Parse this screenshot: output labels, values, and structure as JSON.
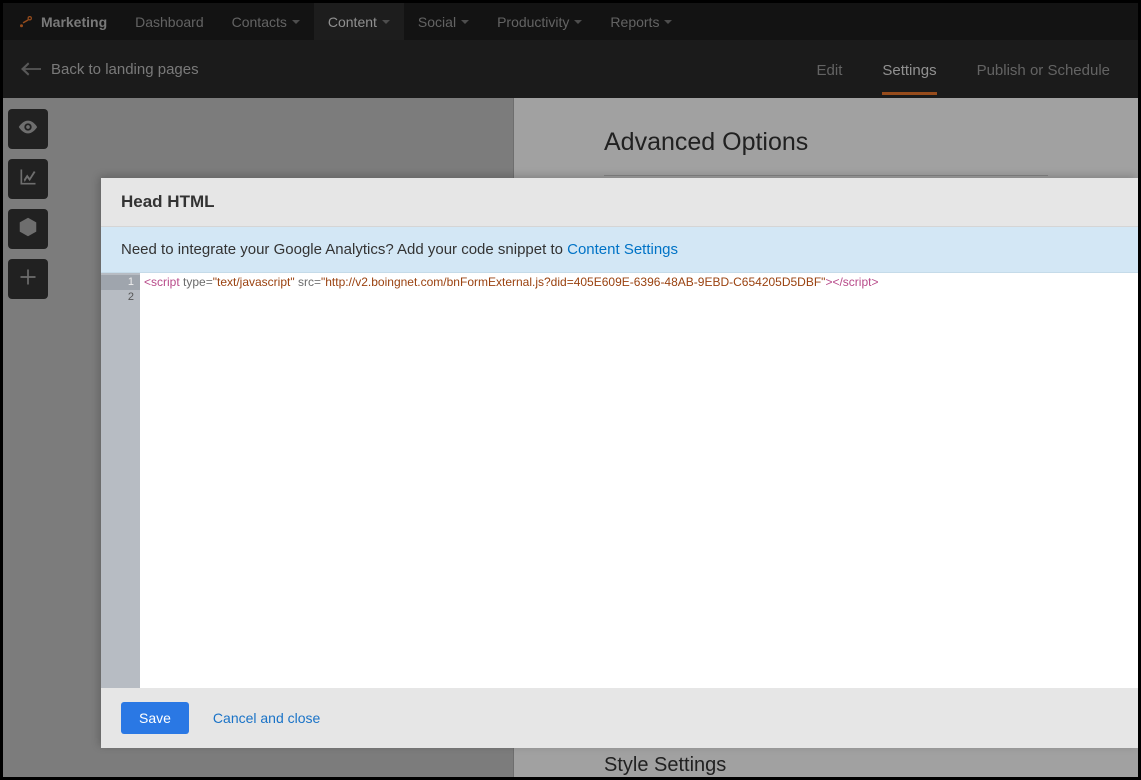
{
  "brand": "Marketing",
  "nav": {
    "dashboard": "Dashboard",
    "contacts": "Contacts",
    "content": "Content",
    "social": "Social",
    "productivity": "Productivity",
    "reports": "Reports"
  },
  "back_label": "Back to landing pages",
  "tabs": {
    "edit": "Edit",
    "settings": "Settings",
    "publish": "Publish or Schedule"
  },
  "panel": {
    "advanced": "Advanced Options",
    "style": "Style Settings"
  },
  "modal": {
    "title": "Head HTML",
    "info_prefix": "Need to integrate your Google Analytics? Add your code snippet to ",
    "info_link": "Content Settings",
    "save": "Save",
    "cancel": "Cancel and close",
    "code": {
      "t_open": "<script",
      "a_type": " type",
      "eq1": "=",
      "v_type": "\"text/javascript\"",
      "a_src": " src",
      "eq2": "=",
      "v_src": "\"http://v2.boingnet.com/bnFormExternal.js?did=405E609E-6396-48AB-9EBD-C654205D5DBF\"",
      "t_mid": ">",
      "t_close": "</script>"
    },
    "lines": {
      "l1": "1",
      "l2": "2"
    }
  }
}
